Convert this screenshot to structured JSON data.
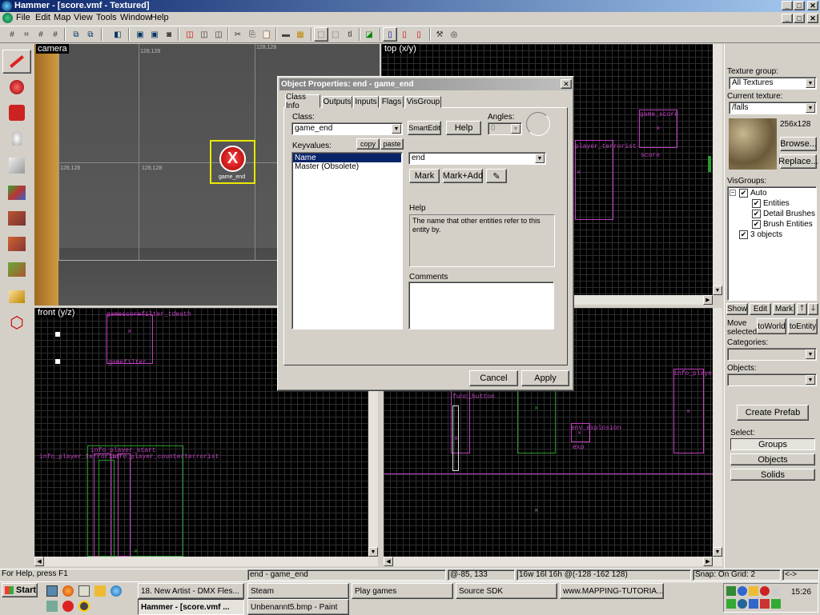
{
  "window": {
    "title": "Hammer - [score.vmf - Textured]"
  },
  "menu": [
    "File",
    "Edit",
    "Map",
    "View",
    "Tools",
    "Window",
    "Help"
  ],
  "viewports": {
    "camera": {
      "label": "camera",
      "grid_label_1": "128,128",
      "grid_label_2": "128,128",
      "grid_label_3": "128,128",
      "grid_label_4": "128,128",
      "entity_name": "game_end"
    },
    "top": {
      "label": "top (x/y)"
    },
    "front": {
      "label": "front (y/z)"
    }
  },
  "entities": {
    "top": [
      "game_score",
      "player_terrorist",
      "score",
      "info_player",
      "env_explosion",
      "exp",
      "func_button"
    ],
    "front": [
      "gamescorefilter_tdeath",
      "gamefilter",
      "info_player_start",
      "info_player_terrorist",
      "info_player_counterterrorist"
    ]
  },
  "dialog": {
    "title": "Object Properties: end - game_end",
    "tabs": [
      "Class Info",
      "Outputs",
      "Inputs",
      "Flags",
      "VisGroup"
    ],
    "class_label": "Class:",
    "class_value": "game_end",
    "smartedit": "SmartEdit",
    "help_btn": "Help",
    "angles_label": "Angles:",
    "angles_value": "0",
    "keyvalues_label": "Keyvalues:",
    "copy": "copy",
    "paste": "paste",
    "keyvalues": [
      "Name",
      "Master (Obsolete)"
    ],
    "value": "end",
    "mark": "Mark",
    "mark_add": "Mark+Add",
    "help_label": "Help",
    "help_text": "The name that other entities refer to this entity by.",
    "comments_label": "Comments",
    "cancel": "Cancel",
    "apply": "Apply"
  },
  "rightpanel": {
    "texture_group_label": "Texture group:",
    "texture_group": "All Textures",
    "current_texture_label": "Current texture:",
    "current_texture": "/falls",
    "texture_size": "256x128",
    "browse": "Browse...",
    "replace": "Replace...",
    "visgroups_label": "VisGroups:",
    "visgroups": [
      {
        "label": "Auto",
        "indent": 1
      },
      {
        "label": "Entities",
        "indent": 2
      },
      {
        "label": "Detail Brushes",
        "indent": 2
      },
      {
        "label": "Brush Entities",
        "indent": 2
      },
      {
        "label": "3 objects",
        "indent": 1
      }
    ],
    "show": "Show",
    "edit": "Edit",
    "mark": "Mark",
    "move_selected": "Move selected:",
    "to_world": "toWorld",
    "to_entity": "toEntity",
    "categories_label": "Categories:",
    "objects_label": "Objects:",
    "create_prefab": "Create Prefab",
    "select_label": "Select:",
    "groups": "Groups",
    "objects": "Objects",
    "solids": "Solids"
  },
  "statusbar": {
    "help": "For Help, press F1",
    "selection": "end - game_end",
    "coords": "@-85, 133",
    "size": "16w 16l 16h @(-128 -162 128)",
    "snap": "Snap: On Grid: 2",
    "arrows": "<->"
  },
  "taskbar": {
    "start": "Start",
    "tasks": [
      "18. New Artist - DMX Fles...",
      "Steam",
      "Play games",
      "Source SDK",
      "www.MAPPING-TUTORIA...",
      "Hammer - [score.vmf ...",
      "Unbenannt5.bmp - Paint"
    ],
    "clock": "15:26"
  },
  "colors": {
    "entity": "#c040c0",
    "brush": "#2a9a2a",
    "selection": "#e8e800",
    "titlebar": "#0a246a"
  }
}
